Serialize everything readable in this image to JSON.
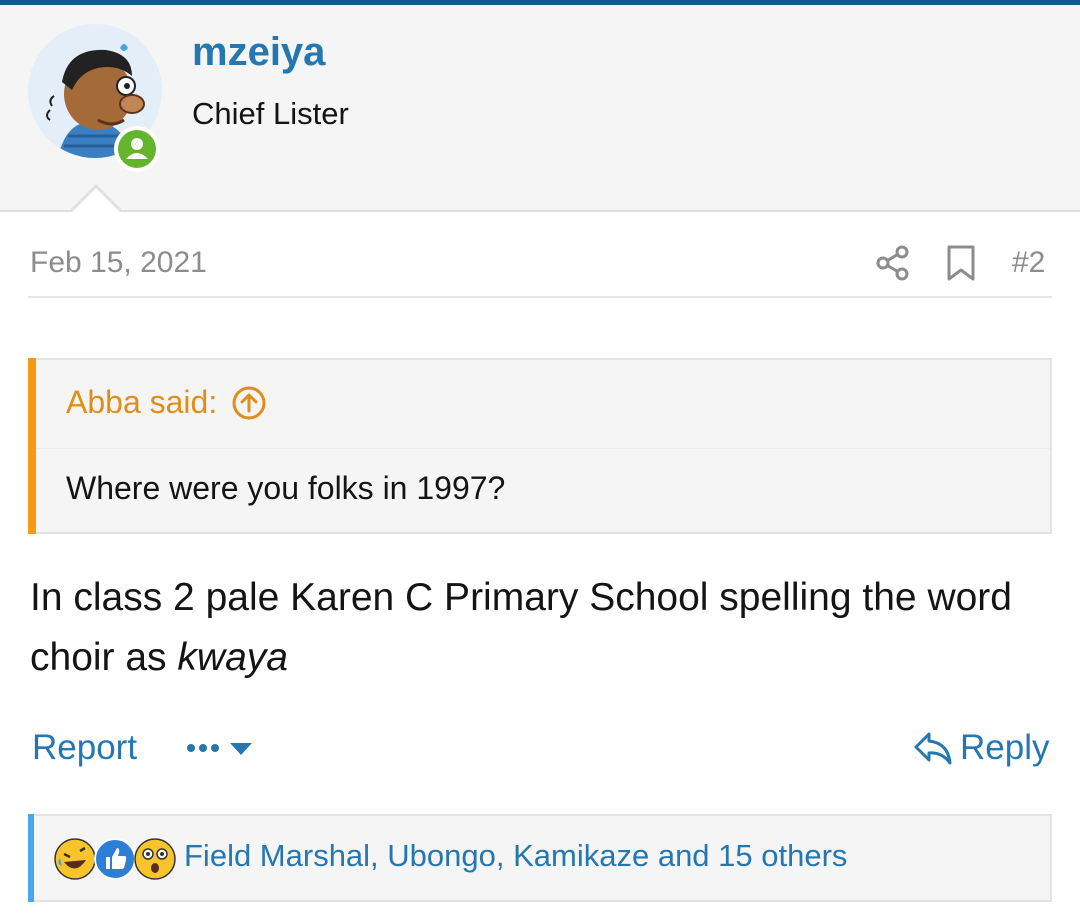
{
  "theme": {
    "accent": "#2577b1",
    "quote_accent": "#f39c12",
    "online": "#64b52d"
  },
  "user": {
    "name": "mzeiya",
    "title": "Chief Lister",
    "avatar_icon": "cartoon-avatar",
    "online_icon": "person-online-icon"
  },
  "meta": {
    "date": "Feb 15, 2021",
    "share_icon": "share-icon",
    "bookmark_icon": "bookmark-icon",
    "post_number": "#2"
  },
  "quote": {
    "author": "Abba said:",
    "jump_icon": "arrow-up-circle-icon",
    "text": "Where were you folks in 1997?"
  },
  "post": {
    "text_main": "In class 2 pale Karen C Primary School spelling the word choir as ",
    "text_italic": "kwaya"
  },
  "actions": {
    "report_label": "Report",
    "more_icon": "ellipsis-caret-icon",
    "reply_label": "Reply",
    "reply_icon": "reply-arrow-icon"
  },
  "reactions": {
    "icons": [
      "laugh-emoji-icon",
      "like-thumb-icon",
      "wow-emoji-icon"
    ],
    "summary": "Field Marshal, Ubongo, Kamikaze and 15 others"
  }
}
